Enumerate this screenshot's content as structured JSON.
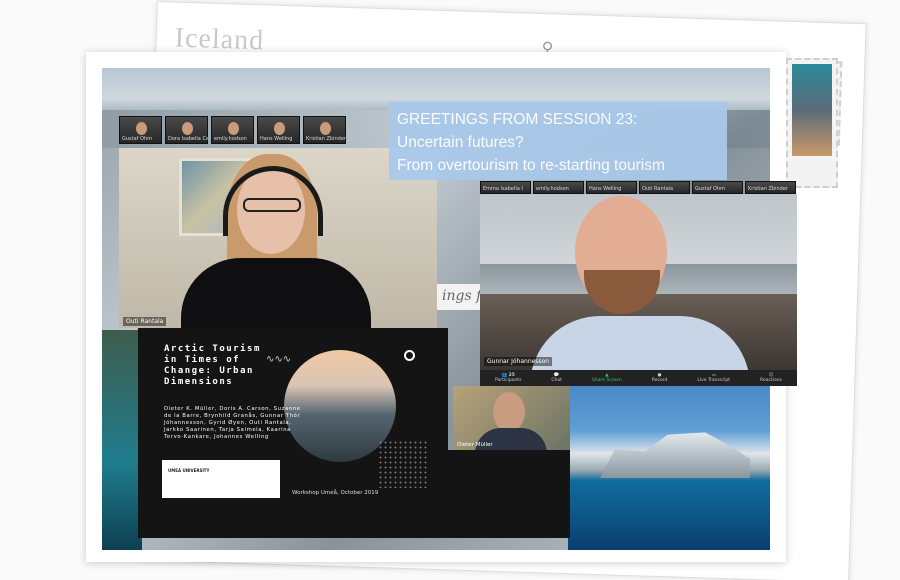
{
  "postcard": {
    "back_title": "Iceland",
    "greeting_handwriting": "ings fro"
  },
  "banner": {
    "line1": "GREETINGS FROM SESSION 23:",
    "line2": "Uncertain futures?",
    "line3": "From overtourism to re-starting tourism"
  },
  "gallery_left": [
    {
      "name": "Gustaf Ohm"
    },
    {
      "name": "Dora Isabella Carson"
    },
    {
      "name": "emily.hodson"
    },
    {
      "name": "Hans Welling"
    },
    {
      "name": "Kristian Zbinden"
    }
  ],
  "gallery_right": [
    {
      "name": "Emma Isabella Carson"
    },
    {
      "name": "emily.hodson"
    },
    {
      "name": "Hans Welling"
    },
    {
      "name": "Outi Rantala"
    },
    {
      "name": "Gustaf Ohm"
    },
    {
      "name": "Kristian Zbinden"
    }
  ],
  "videos": {
    "left_speaker_label": "Outi Rantala",
    "right_speaker_label": "Gunnar Jóhannesson",
    "dieter_label": "Dieter Müller"
  },
  "zoom_toolbar": {
    "items": [
      "Participants",
      "Chat",
      "Share Screen",
      "Record",
      "Live Transcript",
      "Reactions"
    ],
    "participants_count": "25"
  },
  "slide": {
    "title": "Arctic Tourism in Times of Change: Urban Dimensions",
    "authors": "Dieter K. Müller, Doris A. Carson, Suzanne de la Barre, Brynhild Granås, Gunnar Thór Jóhannesson, Gyrid Øyen, Outi Rantala, Jarkko Saarinen, Tarja Salmela, Kaarina Tervo-Kankare, Johannes Welling",
    "footer": "Workshop Umeå, October 2019",
    "logo_text": "UMEÅ UNIVERSITY"
  },
  "colors": {
    "banner_bg": "#a9c9ea",
    "share_screen": "#3fc36b"
  }
}
